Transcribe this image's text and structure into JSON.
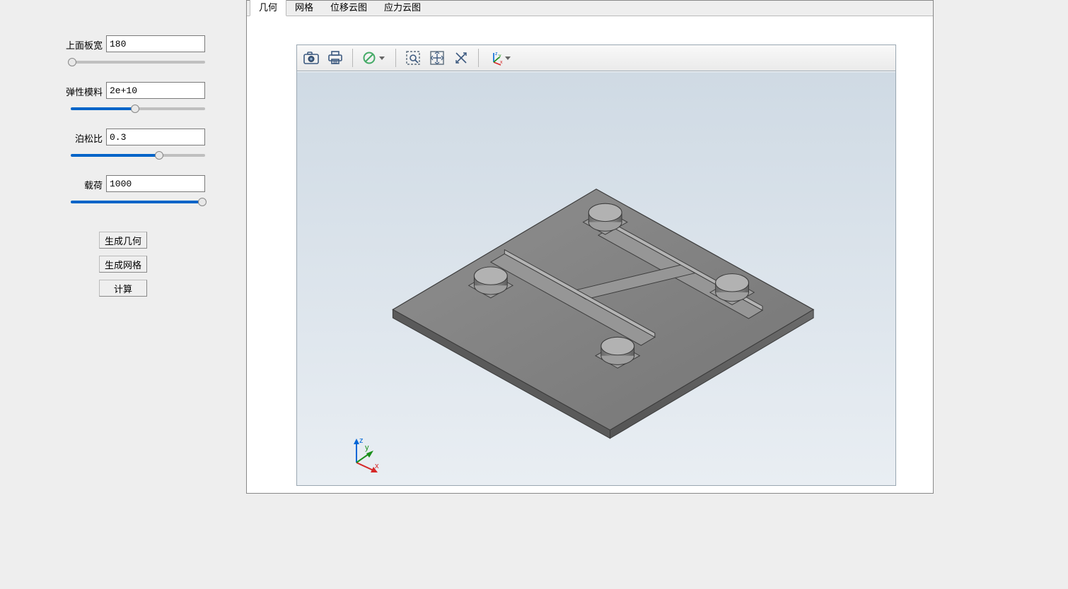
{
  "sidebar": {
    "params": [
      {
        "label": "上面板宽",
        "value": "180",
        "slider_pct": 0
      },
      {
        "label": "弹性模料",
        "value": "2e+10",
        "slider_pct": 48
      },
      {
        "label": "泊松比",
        "value": "0.3",
        "slider_pct": 66
      },
      {
        "label": "载荷",
        "value": "1000",
        "slider_pct": 98
      }
    ],
    "buttons": {
      "gen_geometry": "生成几何",
      "gen_mesh": "生成网格",
      "compute": "计算"
    }
  },
  "tabs": {
    "items": [
      "几何",
      "网格",
      "位移云图",
      "应力云图"
    ],
    "active_index": 0
  },
  "viewport_toolbar": {
    "icons": [
      "camera",
      "printer",
      "nullify",
      "zoom-box",
      "fit-view",
      "rotate-select",
      "axis-view"
    ]
  },
  "axis": {
    "x": "x",
    "y": "y",
    "z": "z"
  }
}
